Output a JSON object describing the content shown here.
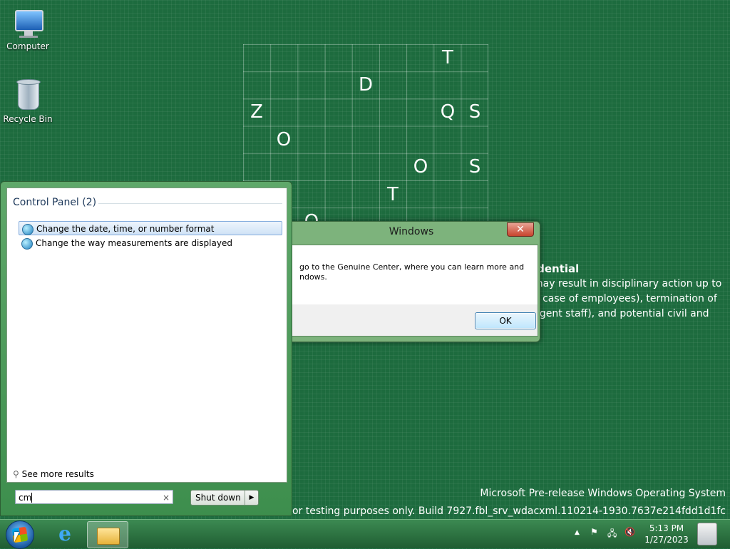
{
  "desktop": {
    "icons": [
      {
        "label": "Computer"
      },
      {
        "label": "Recycle Bin"
      }
    ],
    "grid_letters": [
      "T",
      "D",
      "Z",
      "Q",
      "S",
      "O",
      "O",
      "S",
      "T",
      "O"
    ],
    "confidential_title": "idential",
    "confidential_lines": [
      "may result in disciplinary action up to",
      "e case of employees), termination of",
      "ngent staff), and potential civil and"
    ],
    "watermark_line1": "Microsoft Pre-release Windows Operating System",
    "watermark_line2": "For testing purposes only. Build 7927.fbl_srv_wdacxml.110214-1930.7637e214fdd1d1fc"
  },
  "dialog": {
    "title": "Windows",
    "close_glyph": "✕",
    "text_line1": "go to the Genuine Center, where you can learn more and",
    "text_line2": "ndows.",
    "ok_label": "OK"
  },
  "start_menu": {
    "section_label": "Control Panel (2)",
    "items": [
      {
        "label": "Change the date, time, or number format",
        "icon": "control-panel-icon"
      },
      {
        "label": "Change the way measurements are displayed",
        "icon": "control-panel-icon"
      }
    ],
    "see_more": "See more results",
    "search_value": "cm",
    "search_clear": "×",
    "shutdown_label": "Shut down",
    "shutdown_arrow": "▶"
  },
  "taskbar": {
    "tray_up": "▲",
    "flag": "⚑",
    "network": "🖧",
    "volume": "🔇",
    "time": "5:13 PM",
    "date": "1/27/2023"
  }
}
